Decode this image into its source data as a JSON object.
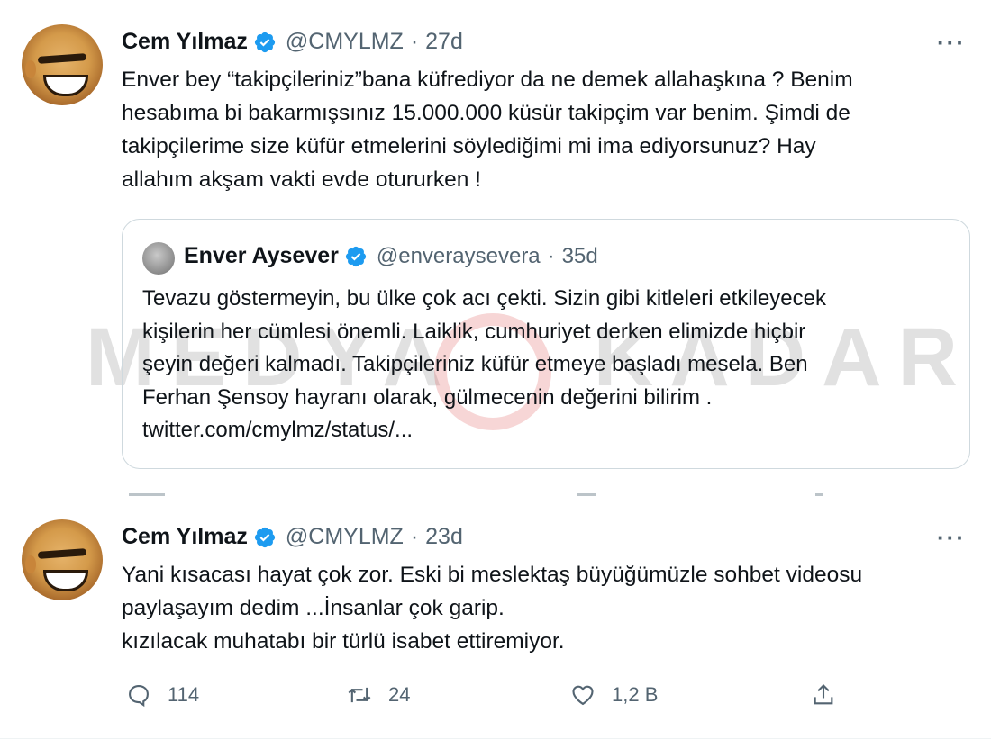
{
  "tweet1": {
    "name": "Cem Yılmaz",
    "handle": "@CMYLMZ",
    "dot": "·",
    "time": "27d",
    "more": "···",
    "lines": [
      "Enver bey “takipçileriniz”bana küfrediyor da ne demek allahaşkına ? Benim",
      "hesabıma bi bakarmışsınız 15.000.000 küsür takipçim var benim. Şimdi de",
      "takipçilerime size küfür etmelerini söylediğimi mi ima ediyorsunuz? Hay",
      "allahım akşam vakti evde otururken !"
    ]
  },
  "quote": {
    "name": "Enver Aysever",
    "handle": "@enveraysevera",
    "dot": "·",
    "time": "35d",
    "lines": [
      "Tevazu göstermeyin, bu ülke çok acı çekti. Sizin gibi kitleleri etkileyecek",
      "kişilerin her cümlesi önemli. Laiklik, cumhuriyet derken elimizde hiçbir",
      "şeyin değeri kalmadı. Takipçileriniz küfür etmeye başladı mesela. Ben",
      "Ferhan Şensoy hayranı olarak, gülmecenin değerini bilirim .",
      "twitter.com/cmylmz/status/..."
    ]
  },
  "watermark": {
    "left": "MEDYA",
    "right": "KADAR"
  },
  "tweet2": {
    "name": "Cem Yılmaz",
    "handle": "@CMYLMZ",
    "dot": "·",
    "time": "23d",
    "more": "···",
    "lines": [
      "Yani kısacası hayat çok zor. Eski bi meslektaş büyüğümüzle sohbet videosu",
      "paylaşayım dedim ...İnsanlar çok garip.",
      "kızılacak  muhatabı bir türlü isabet ettiremiyor."
    ],
    "actions": {
      "reply_count": "114",
      "retweet_count": "24",
      "like_count": "1,2 B"
    }
  },
  "colors": {
    "verified": "#1d9bf0",
    "secondary_text": "#536471",
    "text": "#0f1419"
  }
}
